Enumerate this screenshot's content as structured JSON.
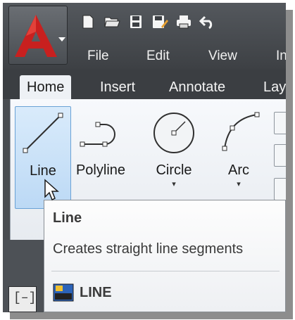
{
  "app": {
    "logo_letter": "A"
  },
  "quick_access": {
    "icons": [
      "new-file-icon",
      "open-folder-icon",
      "save-icon",
      "save-as-icon",
      "print-icon",
      "undo-icon"
    ]
  },
  "menu": {
    "file": "File",
    "edit": "Edit",
    "view": "View",
    "insert_partial": "In"
  },
  "ribbon_tabs": {
    "home": "Home",
    "insert": "Insert",
    "annotate": "Annotate",
    "layout_partial": "Lay"
  },
  "tools": {
    "line": "Line",
    "polyline": "Polyline",
    "circle": "Circle",
    "arc": "Arc",
    "dropdown_glyph": "▾"
  },
  "tooltip": {
    "title": "Line",
    "description": "Creates straight line segments",
    "command": "LINE"
  },
  "document_tab": {
    "glyph": "[–]"
  },
  "colors": {
    "accent_red": "#c8201f",
    "highlight_blue": "#bcd9f5",
    "dark_chrome": "#3b3e42"
  }
}
